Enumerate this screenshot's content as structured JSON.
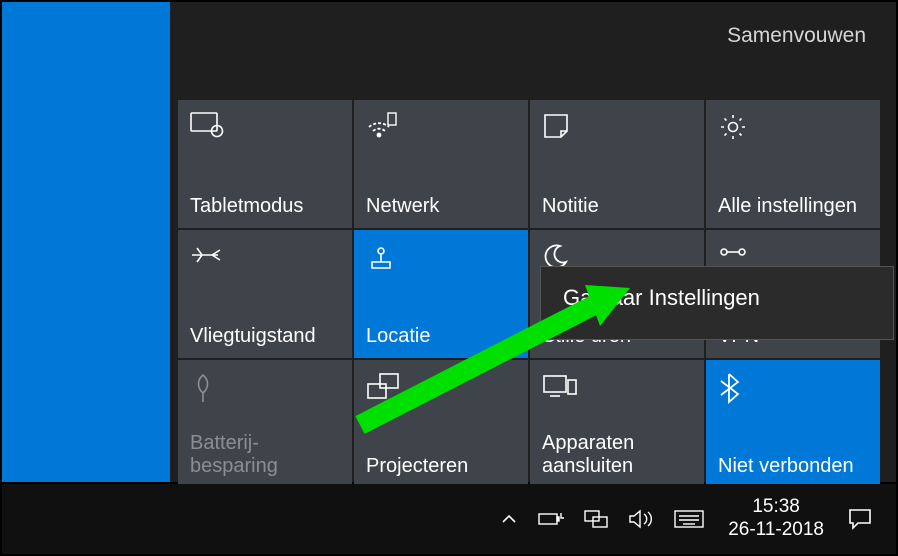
{
  "collapse_label": "Samenvouwen",
  "tiles": {
    "r0": [
      {
        "label": "Tabletmodus",
        "active": false
      },
      {
        "label": "Netwerk",
        "active": false
      },
      {
        "label": "Notitie",
        "active": false
      },
      {
        "label": "Alle instellingen",
        "active": false
      }
    ],
    "r1": [
      {
        "label": "Vliegtuigstand",
        "active": false
      },
      {
        "label": "Locatie",
        "active": true
      },
      {
        "label": "Stille uren",
        "active": false
      },
      {
        "label": "VPN",
        "active": false
      }
    ],
    "r2": [
      {
        "label": "Batterij-besparing",
        "active": false,
        "disabled": true
      },
      {
        "label": "Projecteren",
        "active": false
      },
      {
        "label": "Apparaten aansluiten",
        "active": false
      },
      {
        "label": "Niet verbonden",
        "active": true
      }
    ]
  },
  "context_menu": {
    "item": "Ga naar Instellingen"
  },
  "clock": {
    "time": "15:38",
    "date": "26-11-2018"
  }
}
